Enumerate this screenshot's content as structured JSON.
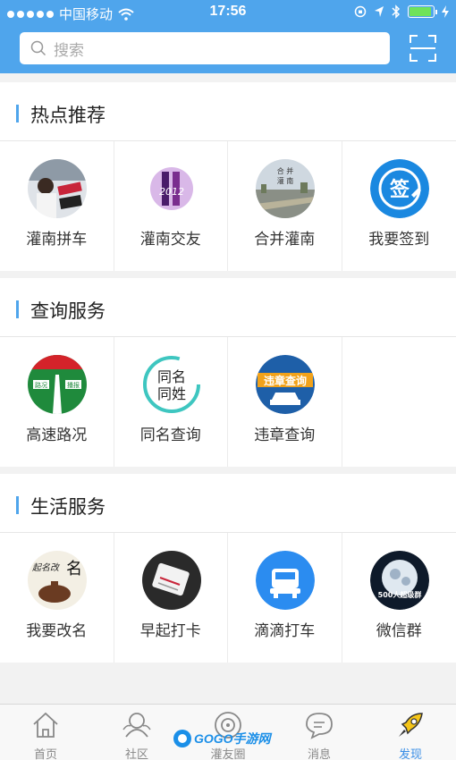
{
  "status_bar": {
    "carrier": "中国移动",
    "time": "17:56"
  },
  "search": {
    "placeholder": "搜索"
  },
  "sections": [
    {
      "title": "热点推荐",
      "items": [
        {
          "label": "灌南拼车",
          "icon": "carpool-photo-icon"
        },
        {
          "label": "灌南交友",
          "icon": "dating-photo-icon"
        },
        {
          "label": "合并灌南",
          "icon": "merge-guannan-photo-icon"
        },
        {
          "label": "我要签到",
          "icon": "check-in-icon"
        }
      ]
    },
    {
      "title": "查询服务",
      "items": [
        {
          "label": "高速路况",
          "icon": "highway-icon"
        },
        {
          "label": "同名查询",
          "icon": "same-name-icon"
        },
        {
          "label": "违章查询",
          "icon": "violation-icon"
        }
      ]
    },
    {
      "title": "生活服务",
      "items": [
        {
          "label": "我要改名",
          "icon": "rename-photo-icon"
        },
        {
          "label": "早起打卡",
          "icon": "early-rise-photo-icon"
        },
        {
          "label": "滴滴打车",
          "icon": "taxi-icon"
        },
        {
          "label": "微信群",
          "icon": "wechat-group-photo-icon"
        }
      ]
    }
  ],
  "icon_text": {
    "merge_guannan": "合 并\n灌 南",
    "same_name": [
      "同名",
      "同姓"
    ],
    "violation": "违章查询",
    "highway_left": "路况",
    "highway_right": "播报",
    "wechat_group": "500人超级群",
    "rename": "起名改名"
  },
  "bottom_nav": [
    {
      "label": "首页",
      "icon": "home-icon"
    },
    {
      "label": "社区",
      "icon": "community-icon"
    },
    {
      "label": "灌友圈",
      "icon": "friends-circle-icon"
    },
    {
      "label": "消息",
      "icon": "message-icon"
    },
    {
      "label": "发现",
      "icon": "rocket-icon",
      "active": true
    }
  ],
  "watermark": "GOGO手游网",
  "colors": {
    "brand": "#4fa5ec",
    "active_tab": "#3a8ee6"
  }
}
